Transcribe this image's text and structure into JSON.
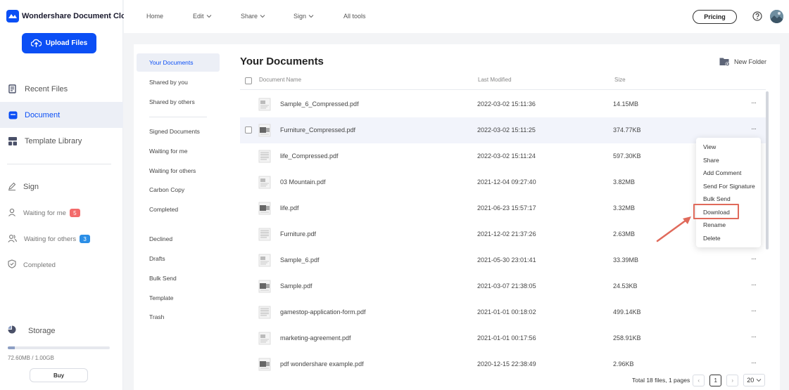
{
  "brand": {
    "name": "Wondershare Document Cloud"
  },
  "sidebar": {
    "upload_label": "Upload Files",
    "nav": [
      {
        "label": "Recent Files",
        "icon": "recent-files-icon"
      },
      {
        "label": "Document",
        "icon": "document-icon",
        "active": true
      },
      {
        "label": "Template Library",
        "icon": "template-library-icon"
      }
    ],
    "sign": {
      "label": "Sign",
      "waiting_for_me": {
        "label": "Waiting for me",
        "count": "5"
      },
      "waiting_for_others": {
        "label": "Waiting for others",
        "count": "3"
      },
      "completed": "Completed"
    },
    "storage": {
      "label": "Storage",
      "used_text": "72.60MB / 1.00GB",
      "used_fraction": 0.07,
      "buy_label": "Buy"
    }
  },
  "topnav": {
    "home": "Home",
    "edit": "Edit",
    "share": "Share",
    "sign": "Sign",
    "all_tools": "All tools",
    "pricing": "Pricing"
  },
  "folders": {
    "group1": [
      "Your Documents",
      "Shared by you",
      "Shared by others"
    ],
    "group2": [
      "Signed Documents",
      "Waiting for me",
      "Waiting for others",
      "Carbon Copy",
      "Completed"
    ],
    "group3": [
      "Declined",
      "Drafts",
      "Bulk Send",
      "Template",
      "Trash"
    ]
  },
  "documents": {
    "title": "Your Documents",
    "new_folder": "New Folder",
    "columns": {
      "name": "Document Name",
      "modified": "Last Modified",
      "size": "Size"
    },
    "rows": [
      {
        "name": "Sample_6_Compressed.pdf",
        "modified": "2022-03-02 15:11:36",
        "size": "14.15MB"
      },
      {
        "name": "Furniture_Compressed.pdf",
        "modified": "2022-03-02 15:11:25",
        "size": "374.77KB"
      },
      {
        "name": "life_Compressed.pdf",
        "modified": "2022-03-02 15:11:24",
        "size": "597.30KB"
      },
      {
        "name": "03 Mountain.pdf",
        "modified": "2021-12-04 09:27:40",
        "size": "3.82MB"
      },
      {
        "name": "life.pdf",
        "modified": "2021-06-23 15:57:17",
        "size": "3.32MB"
      },
      {
        "name": "Furniture.pdf",
        "modified": "2021-12-02 21:37:26",
        "size": "2.63MB"
      },
      {
        "name": "Sample_6.pdf",
        "modified": "2021-05-30 23:01:41",
        "size": "33.39MB"
      },
      {
        "name": "Sample.pdf",
        "modified": "2021-03-07 21:38:05",
        "size": "24.53KB"
      },
      {
        "name": "gamestop-application-form.pdf",
        "modified": "2021-01-01 00:18:02",
        "size": "499.14KB"
      },
      {
        "name": "marketing-agreement.pdf",
        "modified": "2021-01-01 00:17:56",
        "size": "258.91KB"
      },
      {
        "name": "pdf wondershare example.pdf",
        "modified": "2020-12-15 22:38:49",
        "size": "2.96KB"
      }
    ],
    "more_label": "···"
  },
  "context_menu": [
    "View",
    "Share",
    "Add Comment",
    "Send For Signature",
    "Bulk Send",
    "Download",
    "Rename",
    "Delete"
  ],
  "pagination": {
    "summary": "Total 18 files, 1 pages",
    "current_page": "1",
    "page_size": "20",
    "prev": "‹",
    "next": "›"
  },
  "colors": {
    "accent": "#0b4ff5",
    "annotation": "#e06a5b",
    "badge_red": "#f36b6b",
    "badge_blue": "#2b8ee6"
  }
}
